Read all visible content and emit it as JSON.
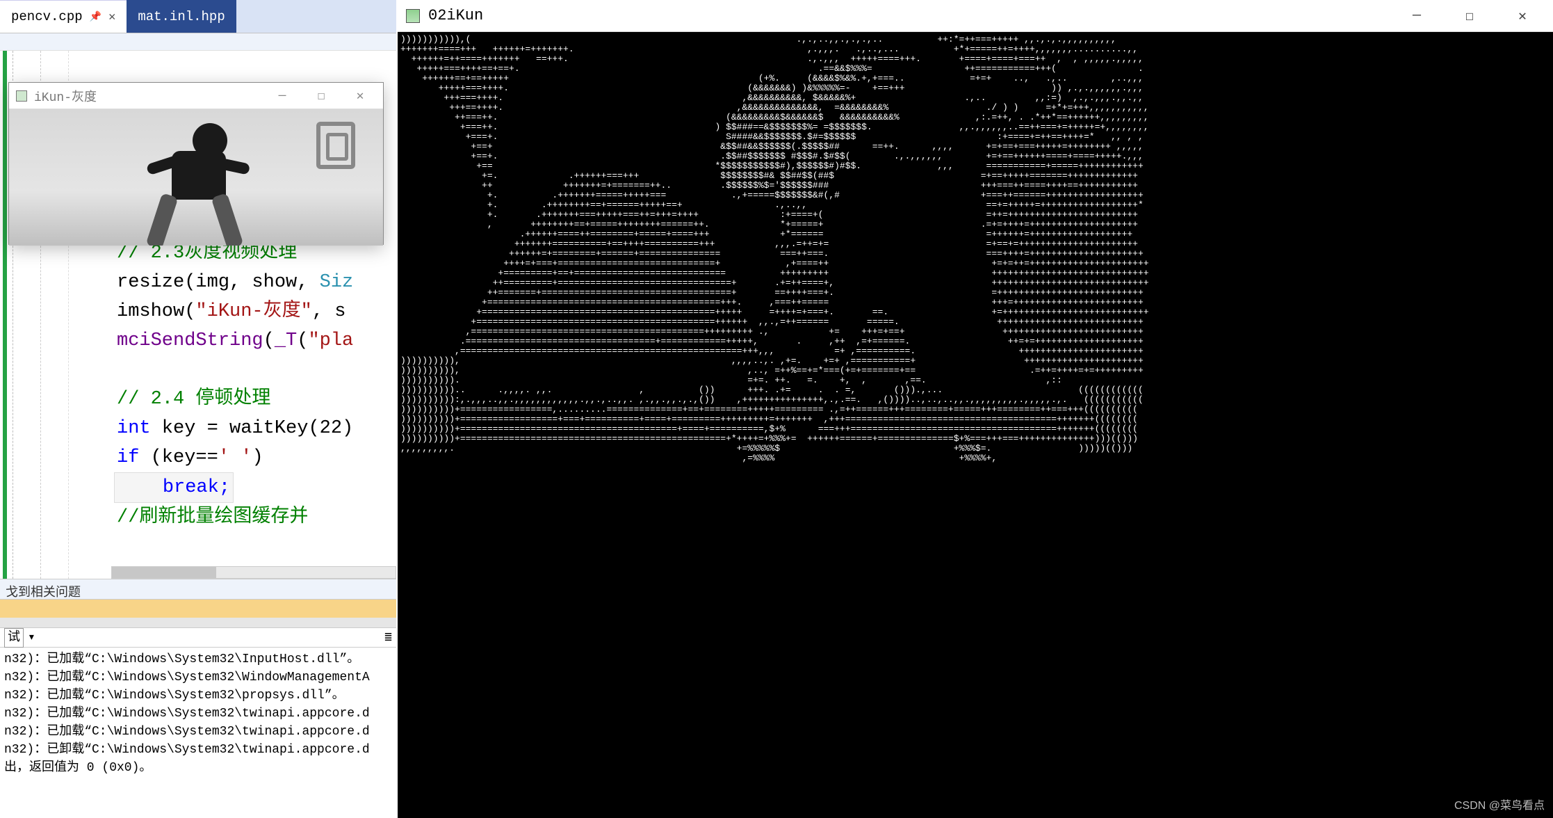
{
  "tabs": {
    "active_file": "pencv.cpp",
    "inactive_file": "mat.inl.hpp",
    "pin_icon": "📌",
    "close_icon": "✕"
  },
  "cv_window": {
    "title": "iKun-灰度",
    "min": "—",
    "max": "☐",
    "close": "✕"
  },
  "code": {
    "c1": "// 2.3灰度视频处理",
    "l2a": "resize",
    "l2b": "(img, show, ",
    "l2c": "Siz",
    "l3a": "imshow",
    "l3b": "(",
    "l3c": "\"iKun-灰度\"",
    "l3d": ", s",
    "l4a": "mciSendString",
    "l4b": "(",
    "l4c": "_T",
    "l4d": "(",
    "l4e": "\"pla",
    "c5": "// 2.4 停顿处理",
    "l6a": "int",
    "l6b": " key = waitKey(22)",
    "l7a": "if",
    "l7b": " (key==",
    "l7c": "' '",
    "l7d": ")",
    "l8": "break;",
    "c9": "//刷新批量绘图缓存并"
  },
  "problems": {
    "text": "戈到相关问题"
  },
  "output": {
    "header_label": "试",
    "lines": [
      "n32)：已加载“C:\\Windows\\System32\\InputHost.dll”。",
      "n32)：已加载“C:\\Windows\\System32\\WindowManagementA",
      "n32)：已加载“C:\\Windows\\System32\\propsys.dll”。",
      "n32)：已加载“C:\\Windows\\System32\\twinapi.appcore.d",
      "n32)：已加载“C:\\Windows\\System32\\twinapi.appcore.d",
      "n32)：已卸载“C:\\Windows\\System32\\twinapi.appcore.d",
      "出，返回值为 0 (0x0)。"
    ]
  },
  "console": {
    "title": "02iKun",
    "min": "—",
    "max": "☐",
    "close": "✕",
    "ascii": "))))))))))),(                                                            .,.,..,,.,.,.,..          ++:*=++===+++++ ,,.,.,.,,,,,,,,,,\n+++++++====+++   ++++++=+++++++.                                           ,.,,,.   .,..,...          +*+=====++=++++,,,,,,,..........,,\n  ++++++=++====+++++++   ==+++.                                            .,.,,,  +++++====+++.       +====+====+===++  ,  , ,,,,,.,,,,,\n   +++++===++++==+==+.                                                       .==&&$%%%=                 ++===========+++(               .\n    ++++++==+==+++++                                              (+%.     (&&&&$%&%.+,+===..            =+=+    ..,   .,..        ,..,,,\n       +++++===++++.                                            (&&&&&&&) )&%%%%%=-    +==+++                           )) ,.,.,,,,,,.,,,\n        +++===++++.                                            ,&&&&&&&&&&, $&&&&&%+                    .,..         ,,:=)  ,.,.,,,.,,.,,\n         +++==++++.                                           ,&&&&&&&&&&&&&&,  =&&&&&&&&%                  ./ ) )     =+*+=+++,,,,,,,,,,,\n          ++===++.                                          (&&&&&&&&&$&&&&&&$   &&&&&&&&&&%              ,:.=++, . .*++*==++++++,,,,,,,,,\n           +===++.                                        ) $$###==&$$$$$$$%= =$$$$$$$.                ,,.,,,,,,..==++===+=+++++=+,,,,,,,,\n            +===+.                                          S####&&$$$$$$$.$#=$$$$$$                          :+====+=++==++++=*   ,, , ,\n             +==+                                          &$$##&&$$$$$$(.$$$$$##      ==++.      ,,,,      +=+==+===+++++=++++++++ ,,,,,\n             +==+.                                         .$$##$$$$$$$ #$$$#.$#$$(        .,.,,,,,,        +=+==++++++====+====+++++.,,,\n              +==                                         *$$$$$$$$$$$#),$$$$$$#)#$$.              ,,,      ===========+=====++++++++++++\n               +=.             .++++++===+++               $$$$$$$$#& $$##$$(##$                           =+==+++++=======+++++++++++++\n               ++             +++++++=+=======++..         .$$$$$$%$='$$$$$$###                            +++===++====++++==+++++++++++\n                +.          .+++++++=====+++++===            .,+=====$$$$$$$&#(,#                          +===++======++++++++++++++++++\n                +.        .++++++++==+======+++++==+                 .,..,,                                 ==+=+++++=++++++++++++++++++*\n                +.       .+++++++===+++++===++=+++=++++               :+====+(                              =++=++++++++++++++++++++++++\n                ,       ++++++++==+=====++++++++======++.             *+=====+                             .=+=++++=++++++++++++++++++++\n                      .++++++====++========+=====+====+++             +*======                              =++++++=+++++++++++++++++++\n                     +++++++==========+==++++==========+++           ,,,.=++=+=                             =+==+=++++++++++++++++++++++\n                    ++++++=+========+======+===============           ===++===.                             ===++++=+++++++++++++++++++++\n                   ++++=+===+=============================+            ,+====++                              +=+=++=++++++++++++++++++++++\n                  +=========+==+============================          +++++++++                              +++++++++++++++++++++++++++++\n                 ++=========+================================+       .+=++====+,                             +++++++++++++++++++++++++++++\n                ++=======+===================================+       ==++++===+.                             =+++++++++++++++++++++++++++\n               +===========================================+++.     ,===++=====                              +++=++++++++++++++++++++++++\n              +===========================================+++++     =++++=+===+.       ==.                   +=+++++++++++++++++++++++++++\n             +============================================++++++  ,,.,=++======       =====.                  +++++++++++++++++++++++++++\n            ,===========================================+++++++++ .,           +=    +++=+==+                  ++++++++++++++++++++++++++\n           .===================================+============+++++,       .     ,++  ,=+======.                  ++=+=++++++++++++++++++++\n          ,====================================================+++,,,           =+ ,==========.                   +++++++++++++++++++++++\n)))))))))),                                                  ,,,,..,. ,+=.    +=+ ,===========+                    ++++++++++++++++++++++\n)))))))))),                                                     ,.., =++%==+=*===(+=+=======+==                     .=++=++++=+=+++++++++\n)))))))))).                                                     =+=. ++.   =.    +,  ,       ,==.                      ,::               \n))))))))))..      .,,,,. ,,.                ,          ())      +++. .+=     .  . =,       ())).,...                         (((((((((((( \n)))))))))):,.,,,..,,.,,,,,,,,,,,,.,,.,..,,. ,.,,.,,.,.,())    ,+++++++++++++++,.,.==.   ,())))..,..,..,,.,,,,,,,,,.,,,,,.,.   ((((((((((( \n))))))))))+=================,.........==============+==+========+++++========= .,=++======+++========+=====+++========++===+++((((((((((\n))))))))))+==================+===+==========+====+=========+++++++++=+++++++  ,+++=======================================+++++++((((((((\n))))))))))+========================================+====+==========,$+%      ===+++======================================+++++++((((((((\n))))))))))+=================================================+*++++=+%%%+=  ++++++======+==============$+%===+++===++++++++++++++)))(()))\n,,,,,,,,,.                                                    +=%%%%%$                                +%%%$=.                )))))(()))\n                                                               ,=%%%%                                  +%%%%+,"
  },
  "watermark": "CSDN @菜鸟看点"
}
